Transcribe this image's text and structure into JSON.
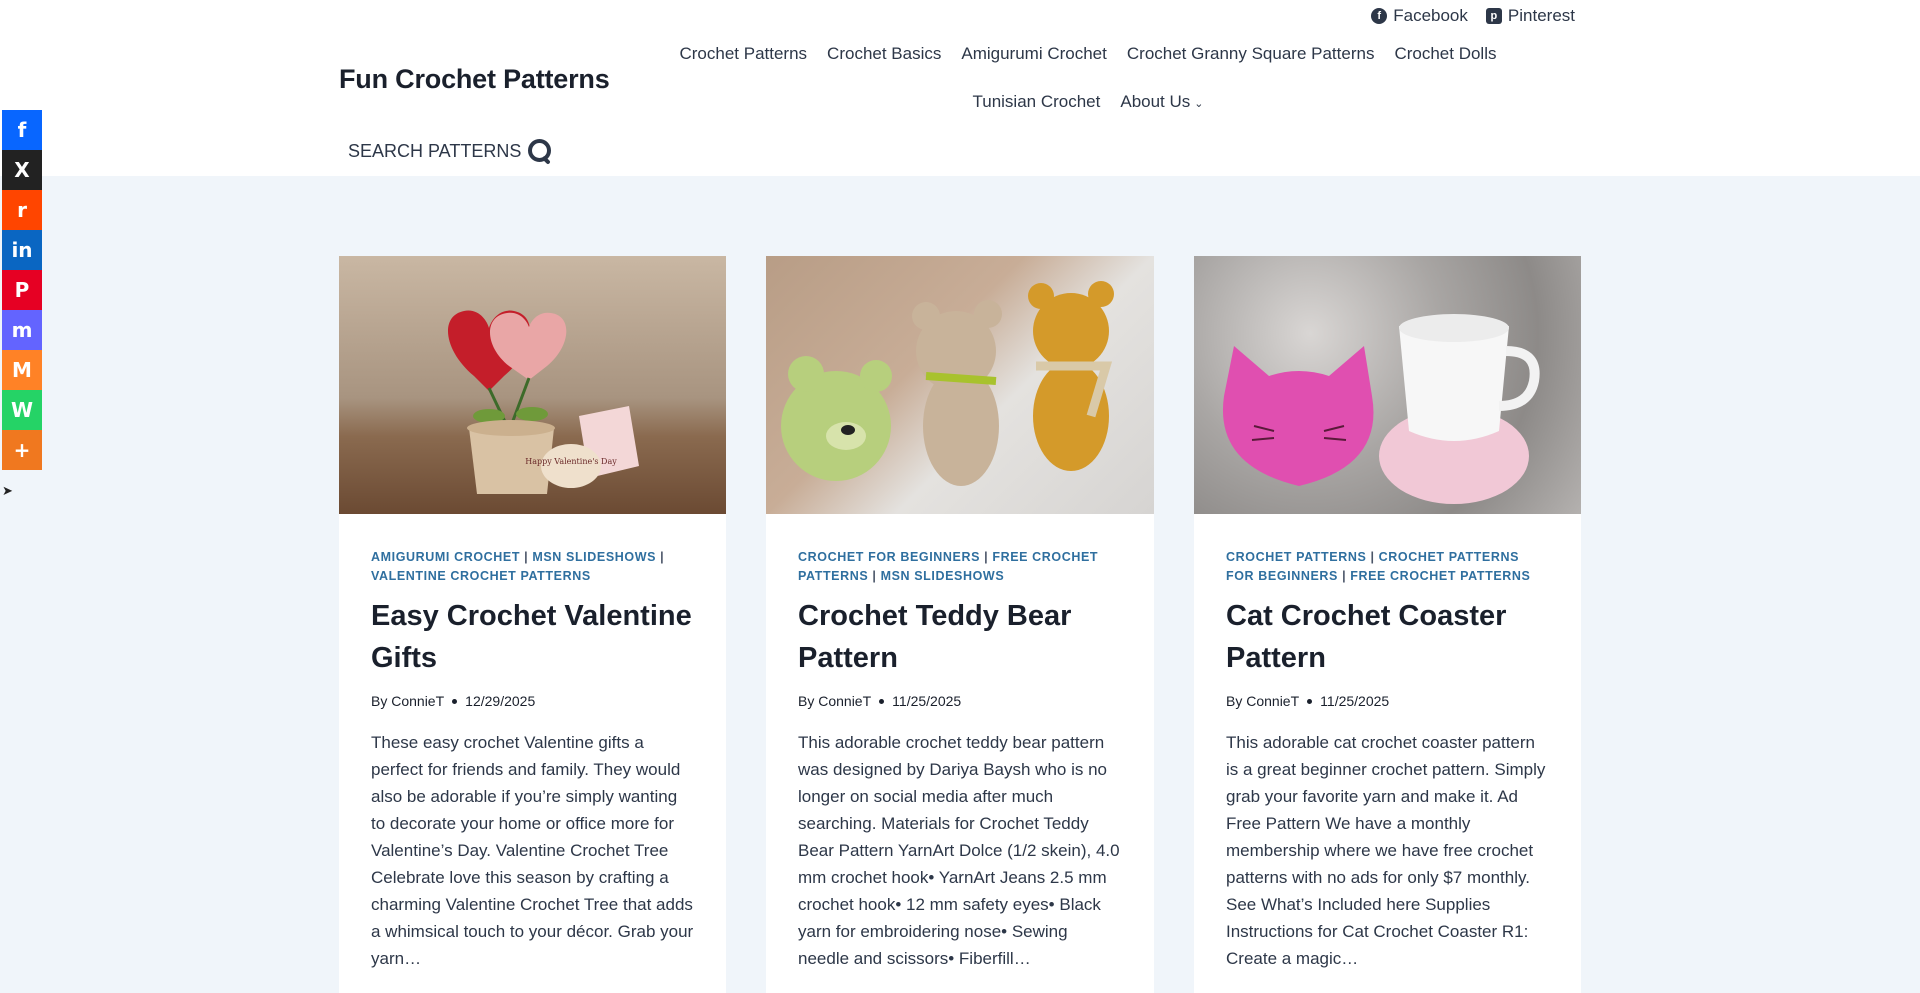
{
  "header": {
    "site_title": "Fun Crochet Patterns",
    "social": [
      {
        "label": "Facebook",
        "icon": "facebook-icon"
      },
      {
        "label": "Pinterest",
        "icon": "pinterest-icon"
      }
    ],
    "nav": [
      {
        "label": "Crochet Patterns"
      },
      {
        "label": "Crochet Basics"
      },
      {
        "label": "Amigurumi Crochet"
      },
      {
        "label": "Crochet Granny Square Patterns"
      },
      {
        "label": "Crochet Dolls"
      },
      {
        "label": "Tunisian Crochet"
      },
      {
        "label": "About Us"
      }
    ],
    "search_label": "SEARCH PATTERNS"
  },
  "sharebar": [
    {
      "name": "facebook-share",
      "color": "#0866ff",
      "glyph": "f"
    },
    {
      "name": "x-share",
      "color": "#222222",
      "glyph": "X"
    },
    {
      "name": "reddit-share",
      "color": "#ff4500",
      "glyph": "r"
    },
    {
      "name": "linkedin-share",
      "color": "#0a66c2",
      "glyph": "in"
    },
    {
      "name": "pinterest-share",
      "color": "#e60023",
      "glyph": "P"
    },
    {
      "name": "mastodon-share",
      "color": "#6364ff",
      "glyph": "m"
    },
    {
      "name": "mix-share",
      "color": "#ff8226",
      "glyph": "M"
    },
    {
      "name": "whatsapp-share",
      "color": "#25d366",
      "glyph": "W"
    },
    {
      "name": "more-share",
      "color": "#f0781f",
      "glyph": "+"
    }
  ],
  "posts": [
    {
      "categories": [
        "AMIGURUMI CROCHET",
        "MSN SLIDESHOWS",
        "VALENTINE CROCHET PATTERNS"
      ],
      "title": "Easy Crochet Valentine Gifts",
      "author": "By ConnieT",
      "date": "12/29/2025",
      "excerpt": "These easy crochet Valentine gifts a perfect for friends and family. They would also be adorable if you’re simply wanting to decorate your home or office more for Valentine’s Day. Valentine Crochet Tree Celebrate love this season by crafting a charming Valentine Crochet Tree that adds a whimsical touch to your décor. Grab your yarn…",
      "image_caption": "Happy Valentine's Day"
    },
    {
      "categories": [
        "CROCHET FOR BEGINNERS",
        "FREE CROCHET PATTERNS",
        "MSN SLIDESHOWS"
      ],
      "title": "Crochet Teddy Bear Pattern",
      "author": "By ConnieT",
      "date": "11/25/2025",
      "excerpt": "This adorable crochet teddy bear pattern was designed by Dariya Baysh who is no longer on social media after much searching. Materials for Crochet Teddy Bear Pattern  YarnArt Dolce (1/2 skein), 4.0 mm crochet hook• YarnArt Jeans 2.5 mm crochet hook• 12 mm safety eyes• Black yarn for embroidering nose• Sewing needle and scissors• Fiberfill…"
    },
    {
      "categories": [
        "CROCHET PATTERNS",
        "CROCHET PATTERNS FOR BEGINNERS",
        "FREE CROCHET PATTERNS"
      ],
      "title": "Cat Crochet Coaster Pattern",
      "author": "By ConnieT",
      "date": "11/25/2025",
      "excerpt": "This adorable cat crochet coaster pattern is a great beginner crochet pattern. Simply grab your favorite yarn and make it. Ad Free Pattern We have a monthly membership where we have free crochet patterns with no ads for only $7 monthly. See What’s Included here Supplies Instructions for Cat Crochet Coaster R1: Create a magic…"
    }
  ]
}
